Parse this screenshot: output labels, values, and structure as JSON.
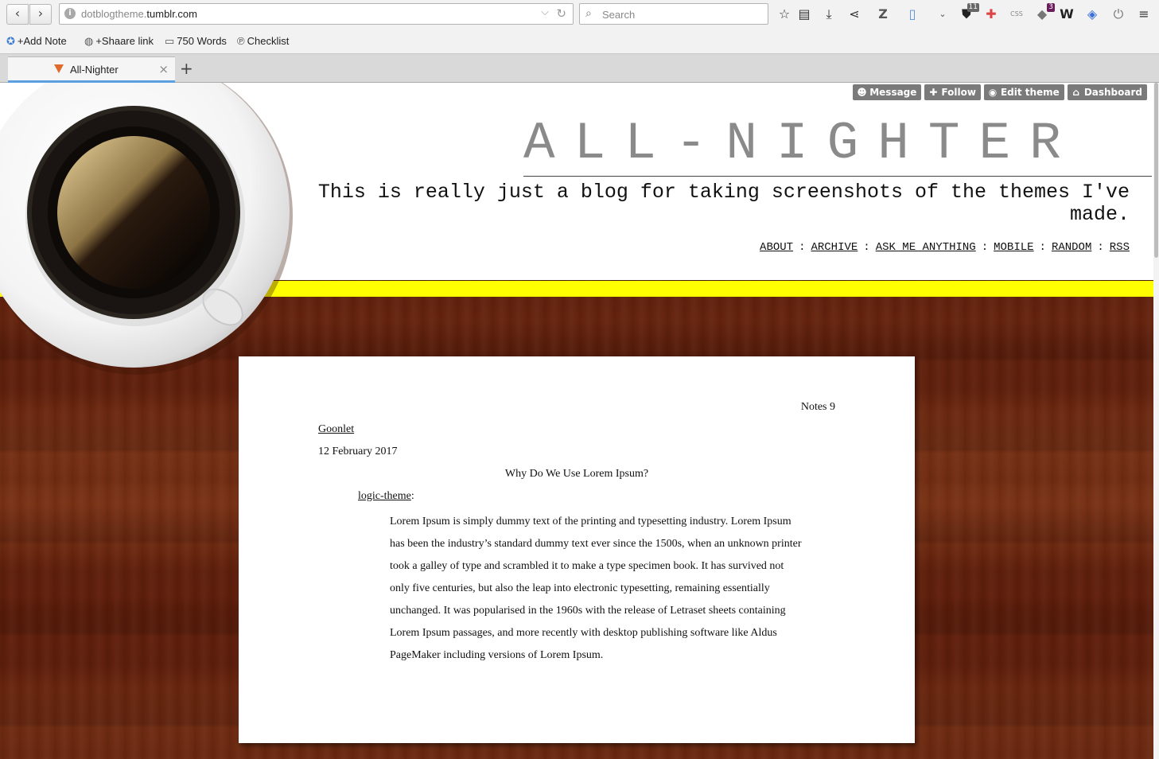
{
  "browser": {
    "url_prefix": "dotblogtheme.",
    "url_host": "tumblr.com",
    "search_placeholder": "Search",
    "toolbar_badges": {
      "ublock": "11",
      "notifications": "3"
    },
    "toolbar_icons": [
      "star-icon",
      "reading-list-icon",
      "download-icon",
      "share-icon",
      "zotero-icon",
      "document-icon",
      "chevron-down-icon",
      "ublock-icon",
      "first-aid-icon",
      "css-icon",
      "extension-icon",
      "wordpress-icon",
      "diamond-icon",
      "power-icon",
      "menu-icon"
    ]
  },
  "bookmarks": [
    {
      "label": "+Add Note",
      "icon": "add-note-icon"
    },
    {
      "label": "+Shaare link",
      "icon": "shaarli-icon"
    },
    {
      "label": "750 Words",
      "icon": "pages-icon"
    },
    {
      "label": "Checklist",
      "icon": "pinboard-icon"
    }
  ],
  "tabs": [
    {
      "title": "All-Nighter",
      "active": true
    }
  ],
  "tumblr_controls": [
    {
      "label": "Message",
      "icon": "smiley-icon"
    },
    {
      "label": "Follow",
      "icon": "plus-icon"
    },
    {
      "label": "Edit theme",
      "icon": "eye-icon"
    },
    {
      "label": "Dashboard",
      "icon": "home-icon"
    }
  ],
  "blog": {
    "title": "ALL-NIGHTER",
    "description": "This is really just a blog for taking screenshots of the themes I've made.",
    "nav": [
      "ABOUT",
      "ARCHIVE",
      "ASK ME ANYTHING",
      "MOBILE",
      "RANDOM",
      "RSS"
    ],
    "nav_separator": ":",
    "accent_color": "#ffff00"
  },
  "post": {
    "notes_label": "Notes",
    "notes_count": "9",
    "author": "Goonlet",
    "date": "12 February 2017",
    "title": "Why Do We Use Lorem Ipsum?",
    "reblog_source": "logic-theme",
    "reblog_colon": ":",
    "body": "Lorem Ipsum is simply dummy text of the printing and typesetting industry. Lorem Ipsum has been the industry’s standard dummy text ever since the 1500s, when an unknown printer took a galley of type and scrambled it to make a type specimen book. It has survived not only five centuries, but also the leap into electronic typesetting, remaining essentially unchanged. It was popularised in the 1960s with the release of Letraset sheets containing Lorem Ipsum passages, and more recently with desktop publishing software like Aldus PageMaker including versions of Lorem Ipsum."
  }
}
